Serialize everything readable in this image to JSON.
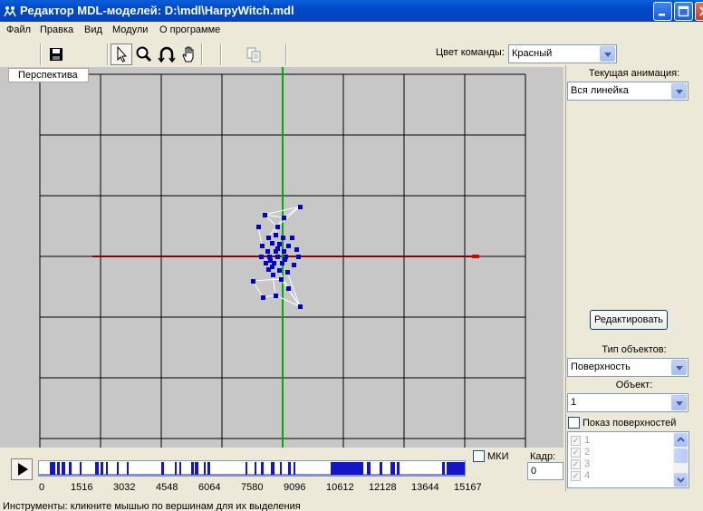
{
  "window": {
    "title": "Редактор MDL-моделей: D:\\mdl\\HarpyWitch.mdl",
    "controls": [
      "minimize-icon",
      "maximize-icon",
      "close-icon"
    ]
  },
  "menu": {
    "file": "Файл",
    "edit": "Правка",
    "view": "Вид",
    "modules": "Модули",
    "about": "О программе"
  },
  "toolbar": {
    "icons": [
      "save-icon",
      "cursor-icon",
      "magnifier-icon",
      "rotate-icon",
      "hand-icon",
      "copy-icon"
    ],
    "team_color_label": "Цвет команды:",
    "team_color_value": "Красный"
  },
  "viewport": {
    "label": "Перспектива",
    "axis_colors": {
      "x": "#8a0000",
      "y": "#00b000",
      "vertex": "#0000cc"
    }
  },
  "right_panel": {
    "current_animation_label": "Текущая анимация:",
    "current_animation_value": "Вся линейка",
    "edit_button": "Редактировать",
    "object_type_label": "Тип объектов:",
    "object_type_value": "Поверхность",
    "object_label": "Объект:",
    "object_value": "1",
    "show_surfaces_label": "Показ поверхностей",
    "surfaces": [
      "1",
      "2",
      "3",
      "4"
    ]
  },
  "timeline": {
    "mki_label": "МКИ",
    "frame_label": "Кадр:",
    "frame_value": "0",
    "ticks": [
      "0",
      "1516",
      "3032",
      "4548",
      "6064",
      "7580",
      "9096",
      "10612",
      "12128",
      "13644",
      "15167"
    ]
  },
  "status": {
    "text": "Инструменты: кликните мышью по вершинам для их выделения"
  }
}
